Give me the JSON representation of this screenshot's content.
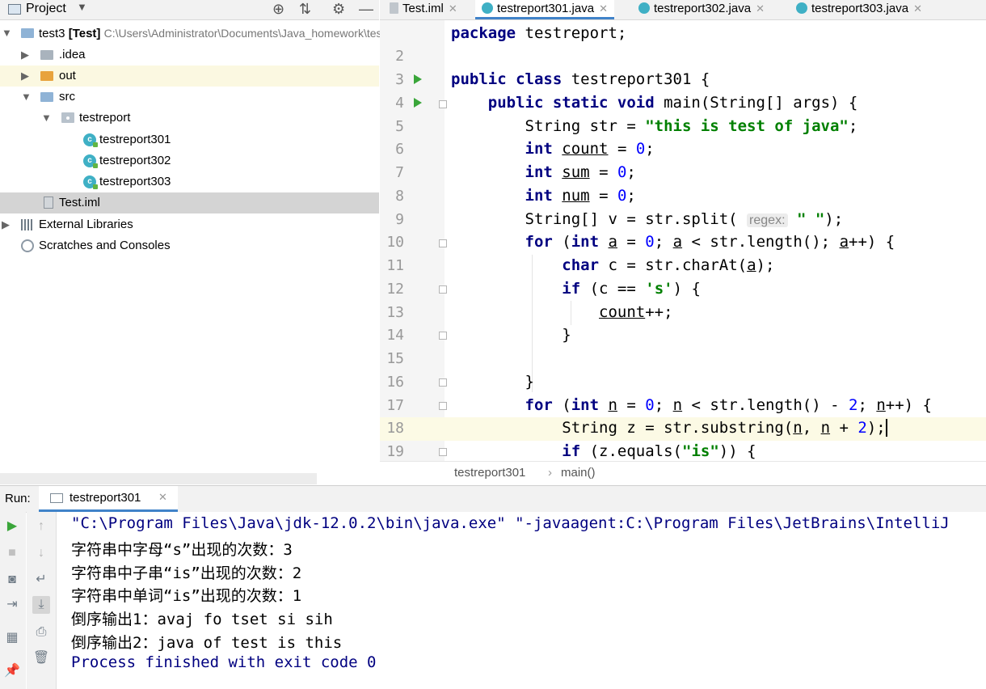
{
  "project_pane": {
    "title": "Project",
    "tree": [
      {
        "label": "test3",
        "module": "[Test]",
        "path": "C:\\Users\\Administrator\\Documents\\Java_homework\\test3"
      },
      {
        "label": ".idea"
      },
      {
        "label": "out"
      },
      {
        "label": "src"
      },
      {
        "label": "testreport"
      },
      {
        "label": "testreport301"
      },
      {
        "label": "testreport302"
      },
      {
        "label": "testreport303"
      },
      {
        "label": "Test.iml"
      },
      {
        "label": "External Libraries"
      },
      {
        "label": "Scratches and Consoles"
      }
    ]
  },
  "tabs": [
    {
      "label": "Test.iml"
    },
    {
      "label": "testreport301.java"
    },
    {
      "label": "testreport302.java"
    },
    {
      "label": "testreport303.java"
    }
  ],
  "editor": {
    "line_numbers": [
      "2",
      "3",
      "4",
      "5",
      "6",
      "7",
      "8",
      "9",
      "10",
      "11",
      "12",
      "13",
      "14",
      "15",
      "16",
      "17",
      "18",
      "19"
    ],
    "hint": "regex:"
  },
  "breadcrumb": {
    "class": "testreport301",
    "method": "main()"
  },
  "run": {
    "label": "Run:",
    "tab": "testreport301",
    "console": [
      "\"C:\\Program Files\\Java\\jdk-12.0.2\\bin\\java.exe\" \"-javaagent:C:\\Program Files\\JetBrains\\IntelliJ",
      "字符串中字母“s”出现的次数：3",
      "字符串中子串“is”出现的次数：2",
      "字符串中单词“is”出现的次数：1",
      "倒序输出1：avaj fo tset si sih",
      "倒序输出2：java of test is this",
      "Process finished with exit code 0"
    ]
  }
}
